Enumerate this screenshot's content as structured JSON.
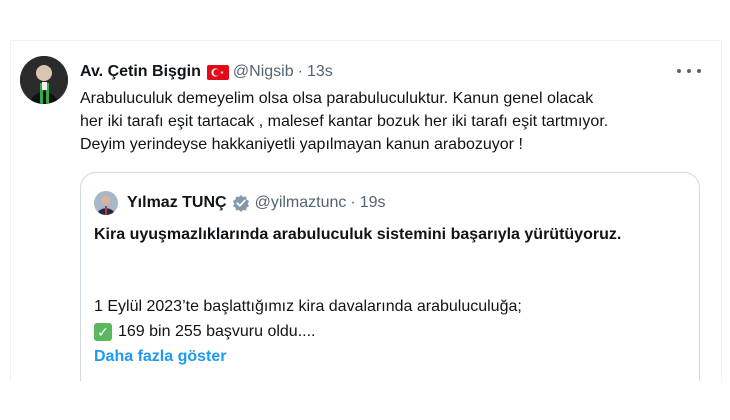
{
  "tweet": {
    "author_name": "Av. Çetin Bişgin",
    "handle": "@Nigsib",
    "time": "13s",
    "separator": "·",
    "text": "Arabuluculuk demeyelim olsa olsa parabuluculuktur. Kanun genel olacak\nher iki tarafı eşit tartacak , malesef kantar bozuk her iki tarafı eşit tartmıyor.\nDeyim yerindeyse hakkaniyetli yapılmayan kanun arabozuyor !",
    "flag_icon": "turkey-flag-icon",
    "more_icon": "more-options-icon"
  },
  "quoted": {
    "author_name": "Yılmaz TUNÇ",
    "handle": "@yilmaztunc",
    "time": "19s",
    "separator": "·",
    "badge_icon": "government-verified-badge-icon",
    "headline": "Kira uyuşmazlıklarında arabuluculuk sistemini başarıyla yürütüyoruz.",
    "line1": "1 Eylül 2023’te başlattığımız kira davalarında arabuluculuğa;",
    "line2": "169 bin 255 başvuru oldu....",
    "check_icon": "check-mark-icon",
    "show_more": "Daha fazla göster"
  },
  "colors": {
    "text_primary": "#0f1419",
    "text_secondary": "#536471",
    "link": "#1d9bf0",
    "border": "#cfd9de",
    "flag_red": "#e30a17",
    "check_green": "#5cb85c"
  }
}
